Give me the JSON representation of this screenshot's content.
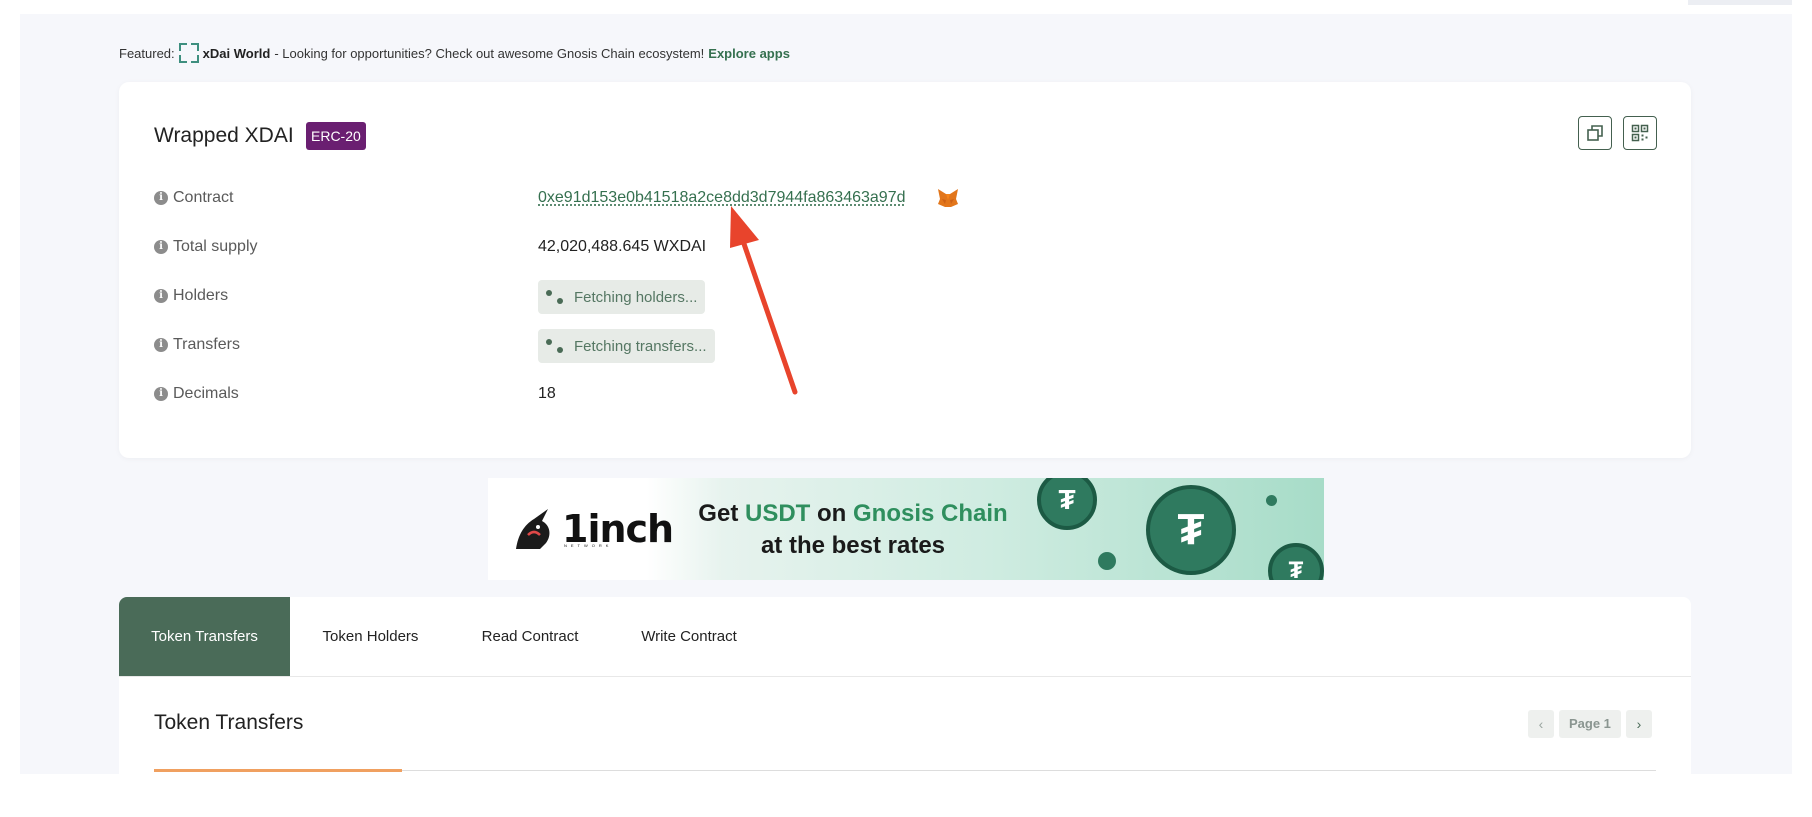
{
  "featured": {
    "prefix": "Featured:",
    "project": "xDai World",
    "message": "- Looking for opportunities? Check out awesome Gnosis Chain ecosystem!",
    "link": "Explore apps"
  },
  "token": {
    "name": "Wrapped XDAI",
    "standard_badge": "ERC-20",
    "rows": {
      "contract": {
        "label": "Contract",
        "value": "0xe91d153e0b41518a2ce8dd3d7944fa863463a97d"
      },
      "total_supply": {
        "label": "Total supply",
        "value": "42,020,488.645 WXDAI"
      },
      "holders": {
        "label": "Holders",
        "value": "Fetching holders..."
      },
      "transfers": {
        "label": "Transfers",
        "value": "Fetching transfers..."
      },
      "decimals": {
        "label": "Decimals",
        "value": "18"
      }
    },
    "actions": {
      "copy_icon": "copy-icon",
      "qr_icon": "qr-code-icon"
    }
  },
  "banner": {
    "brand": "1inch",
    "brand_sub": "NETWORK",
    "get": "Get",
    "usdt": "USDT",
    "on": "on",
    "chain": "Gnosis Chain",
    "line2": "at the best rates",
    "coin_glyph": "₮"
  },
  "tabs": {
    "items": [
      {
        "label": "Token Transfers",
        "active": true
      },
      {
        "label": "Token Holders",
        "active": false
      },
      {
        "label": "Read Contract",
        "active": false
      },
      {
        "label": "Write Contract",
        "active": false
      }
    ]
  },
  "section": {
    "title": "Token Transfers",
    "pager": {
      "prev": "‹",
      "page_label": "Page 1",
      "next": "›"
    }
  },
  "colors": {
    "accent": "#4a6b58",
    "badge": "#6a1f71",
    "link": "#35704f",
    "annotation_arrow": "#e8442c"
  }
}
